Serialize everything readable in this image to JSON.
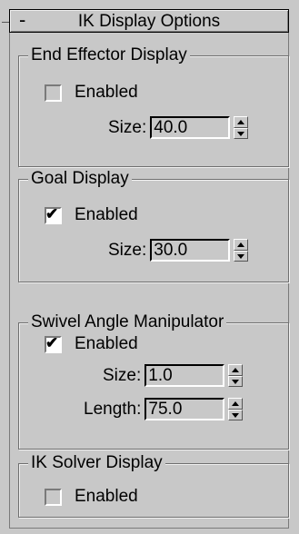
{
  "rollout": {
    "collapse_symbol": "-",
    "title": "IK Display Options"
  },
  "groups": {
    "end_effector": {
      "title": "End Effector Display",
      "enabled": {
        "label": "Enabled",
        "checked": false
      },
      "size": {
        "label": "Size:",
        "value": "40.0"
      }
    },
    "goal": {
      "title": "Goal Display",
      "enabled": {
        "label": "Enabled",
        "checked": true
      },
      "size": {
        "label": "Size:",
        "value": "30.0"
      }
    },
    "swivel": {
      "title": "Swivel Angle Manipulator",
      "enabled": {
        "label": "Enabled",
        "checked": true
      },
      "size": {
        "label": "Size:",
        "value": "1.0"
      },
      "length": {
        "label": "Length:",
        "value": "75.0"
      }
    },
    "ik_solver": {
      "title": "IK Solver Display",
      "enabled": {
        "label": "Enabled",
        "checked": false
      }
    }
  },
  "checkmark_glyph": "✔",
  "icons": {
    "spinner_up": "triangle-up",
    "spinner_down": "triangle-down"
  }
}
